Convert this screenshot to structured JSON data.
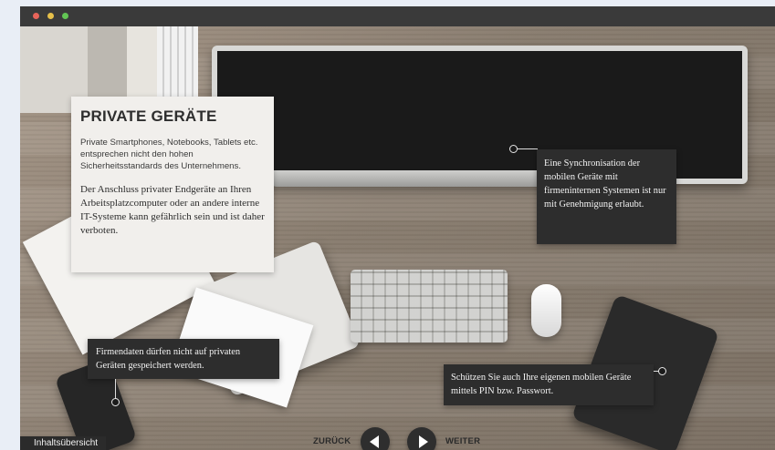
{
  "window": {
    "controls": [
      "close",
      "minimize",
      "maximize"
    ]
  },
  "main_card": {
    "title": "PRIVATE GERÄTE",
    "paragraph1": "Private Smartphones, Notebooks, Tablets etc. entsprechen nicht den hohen Sicherheitsstandards des Unternehmens.",
    "paragraph2": "Der Anschluss privater Endgeräte an Ihren Arbeitsplatzcomputer oder an andere interne IT-Systeme kann gefährlich sein und ist daher verboten."
  },
  "info_boxes": {
    "sync": "Eine Synchronisation der mobilen Geräte mit firmeninternen Systemen ist nur mit Genehmigung erlaubt.",
    "firmendaten": "Firmendaten dürfen nicht auf privaten Geräten gespeichert werden.",
    "schutz": "Schützen Sie auch Ihre eigenen mobilen Geräte mittels PIN bzw. Passwort."
  },
  "navigation": {
    "back_label": "ZURÜCK",
    "next_label": "WEITER",
    "back_icon": "arrow-left-icon",
    "next_icon": "arrow-right-icon"
  },
  "footer": {
    "toc_label": "Inhaltsübersicht"
  }
}
